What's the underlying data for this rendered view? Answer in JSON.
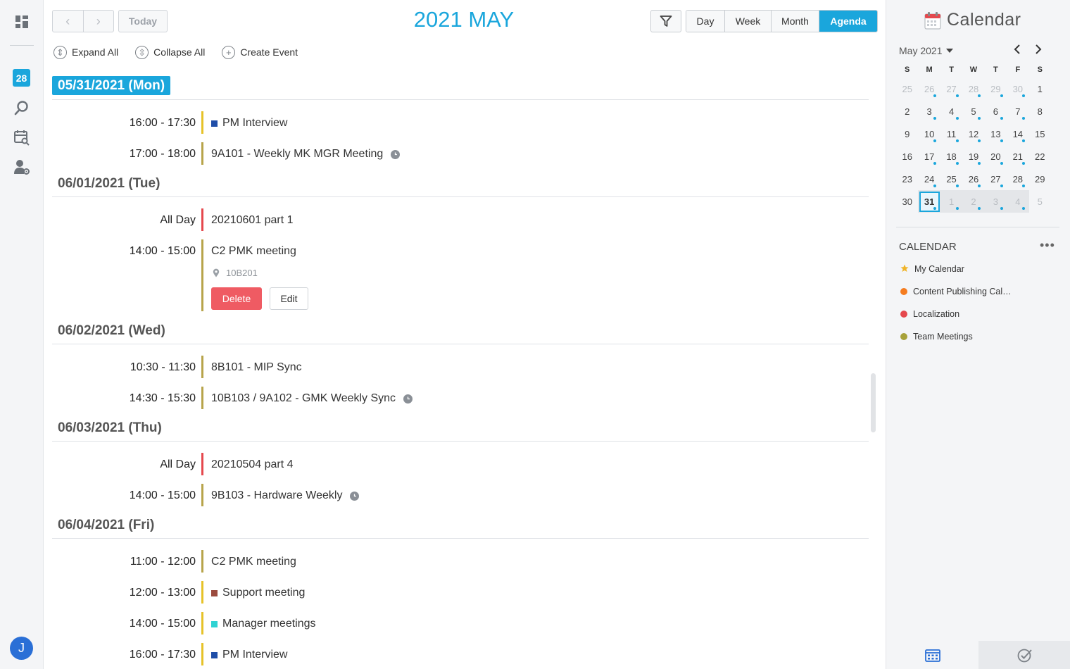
{
  "rail": {
    "date_badge": "28",
    "avatar_initial": "J"
  },
  "header": {
    "prev_glyph": "‹",
    "next_glyph": "›",
    "today_label": "Today",
    "title": "2021 MAY",
    "views": [
      "Day",
      "Week",
      "Month",
      "Agenda"
    ],
    "active_view": "Agenda"
  },
  "actions": {
    "expand_all": "Expand All",
    "collapse_all": "Collapse All",
    "create_event": "Create Event"
  },
  "agenda": {
    "days": [
      {
        "date": "05/31/2021 (Mon)",
        "events": [
          {
            "time": "16:00 - 17:30",
            "title": "PM Interview"
          },
          {
            "time": "17:00 - 18:00",
            "title": "9A101 - Weekly MK MGR Meeting"
          }
        ]
      },
      {
        "date": "06/01/2021 (Tue)",
        "events": [
          {
            "time": "All Day",
            "title": "20210601 part 1"
          },
          {
            "time": "14:00 - 15:00",
            "title": "C2 PMK meeting",
            "location": "10B201",
            "delete_label": "Delete",
            "edit_label": "Edit"
          }
        ]
      },
      {
        "date": "06/02/2021 (Wed)",
        "events": [
          {
            "time": "10:30 - 11:30",
            "title": "8B101 - MIP Sync"
          },
          {
            "time": "14:30 - 15:30",
            "title": "10B103 / 9A102 - GMK Weekly Sync"
          }
        ]
      },
      {
        "date": "06/03/2021 (Thu)",
        "events": [
          {
            "time": "All Day",
            "title": "20210504 part 4"
          },
          {
            "time": "14:00 - 15:00",
            "title": "9B103 - Hardware Weekly"
          }
        ]
      },
      {
        "date": "06/04/2021 (Fri)",
        "events": [
          {
            "time": "11:00 - 12:00",
            "title": "C2 PMK meeting"
          },
          {
            "time": "12:00 - 13:00",
            "title": "Support meeting"
          },
          {
            "time": "14:00 - 15:00",
            "title": "Manager meetings"
          },
          {
            "time": "16:00 - 17:30",
            "title": "PM Interview"
          }
        ]
      }
    ]
  },
  "right_panel": {
    "title": "Calendar",
    "month_label": "May 2021",
    "weekdays": [
      "S",
      "M",
      "T",
      "W",
      "T",
      "F",
      "S"
    ],
    "weeks": [
      [
        "25",
        "26",
        "27",
        "28",
        "29",
        "30",
        "1"
      ],
      [
        "2",
        "3",
        "4",
        "5",
        "6",
        "7",
        "8"
      ],
      [
        "9",
        "10",
        "11",
        "12",
        "13",
        "14",
        "15"
      ],
      [
        "16",
        "17",
        "18",
        "19",
        "20",
        "21",
        "22"
      ],
      [
        "23",
        "24",
        "25",
        "26",
        "27",
        "28",
        "29"
      ],
      [
        "30",
        "31",
        "1",
        "2",
        "3",
        "4",
        "5"
      ]
    ],
    "selected_day": "31",
    "section_title": "CALENDAR",
    "more_glyph": "•••",
    "calendars": [
      {
        "name": "My Calendar",
        "color": "#f0b429"
      },
      {
        "name": "Content Publishing Cal…",
        "color": "#f57c1f"
      },
      {
        "name": "Localization",
        "color": "#e5484d"
      },
      {
        "name": "Team Meetings",
        "color": "#a8a23a"
      }
    ]
  },
  "colors": {
    "accent": "#1aa6dc",
    "bar_yellow": "#e6c229",
    "bar_olive": "#b7a44a",
    "bar_red": "#e5484d",
    "square_blue": "#1f4ea8",
    "square_brown": "#9b4b3e",
    "square_cyan": "#2fd3d3",
    "delete_red": "#ef5b63"
  }
}
